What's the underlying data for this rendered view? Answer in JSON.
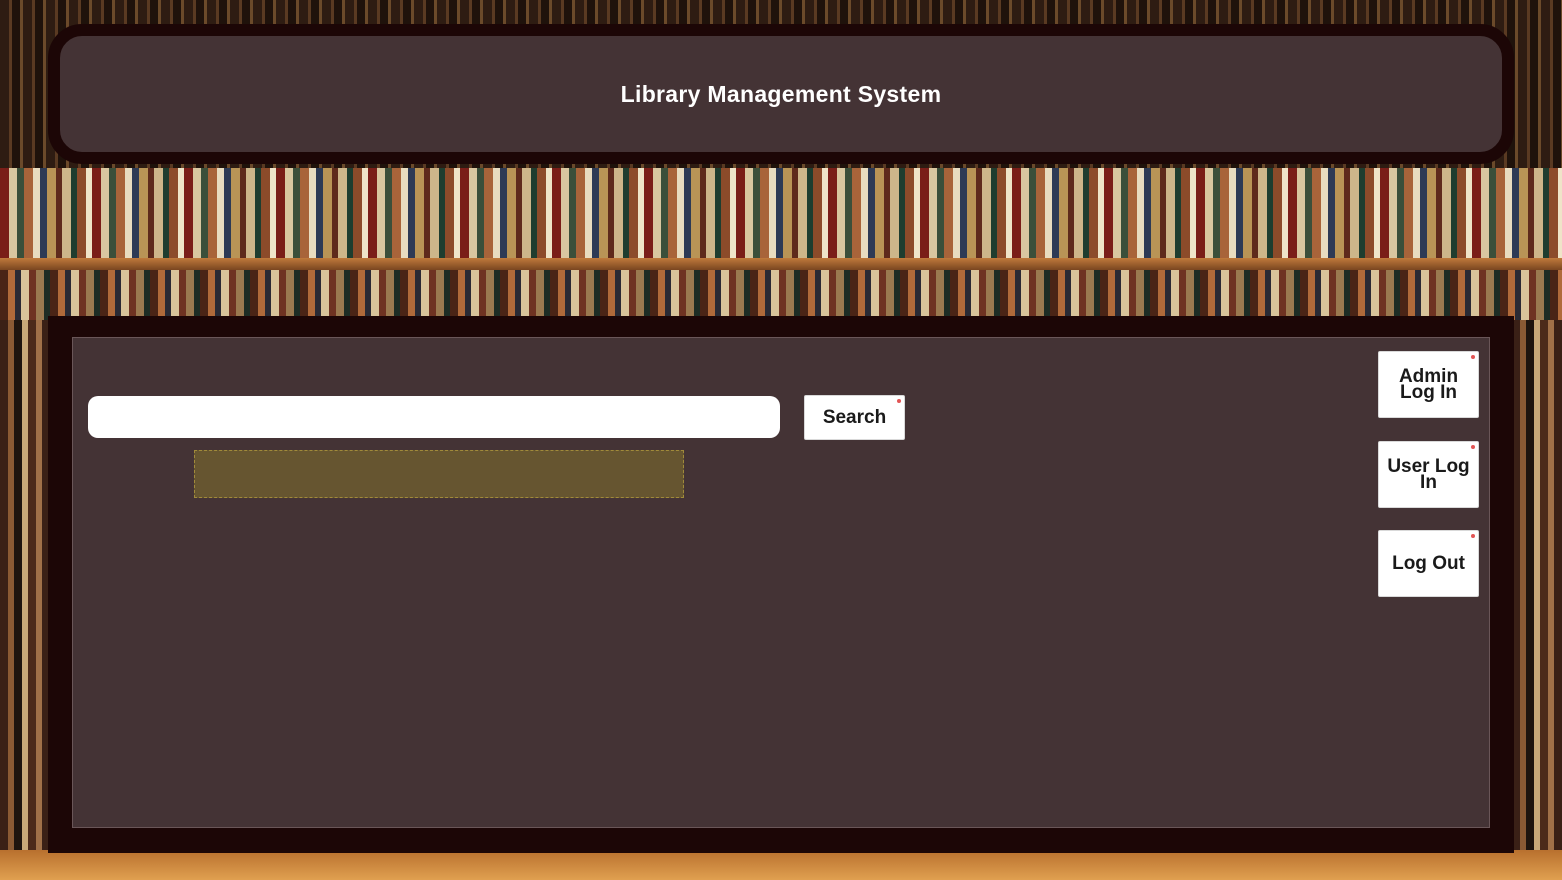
{
  "app": {
    "title": "Library Management System"
  },
  "search": {
    "value": "",
    "placeholder": "",
    "button_label": "Search"
  },
  "auth": {
    "admin_login_label": "Admin Log In",
    "user_login_label": "User Log In",
    "logout_label": "Log Out"
  },
  "colors": {
    "panel": "#443335",
    "frame": "#1c0606",
    "results_highlight": "#665530",
    "button_bg": "#ffffff"
  }
}
